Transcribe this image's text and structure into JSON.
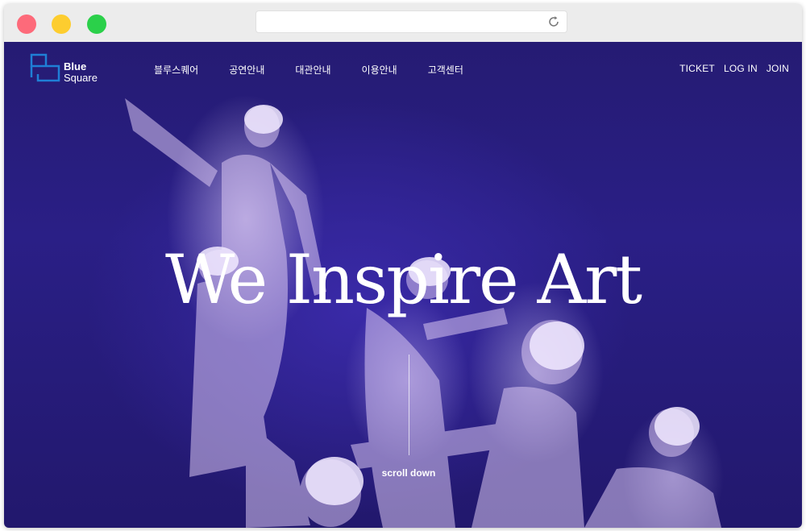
{
  "window": {
    "controls": [
      "close",
      "minimize",
      "maximize"
    ],
    "address_bar": {
      "value": "",
      "reload_icon": "reload-icon"
    }
  },
  "site": {
    "logo": {
      "line1": "Blue",
      "line2": "Square",
      "mark_color": "#1f7fd6"
    },
    "nav": [
      {
        "label": "블루스퀘어"
      },
      {
        "label": "공연안내"
      },
      {
        "label": "대관안내"
      },
      {
        "label": "이용안내"
      },
      {
        "label": "고객센터"
      }
    ],
    "util": [
      {
        "label": "TICKET"
      },
      {
        "label": "LOG IN"
      },
      {
        "label": "JOIN"
      }
    ]
  },
  "hero": {
    "headline": "We Inspire Art",
    "scroll_label": "scroll down",
    "background_color": "#2a1f86"
  }
}
